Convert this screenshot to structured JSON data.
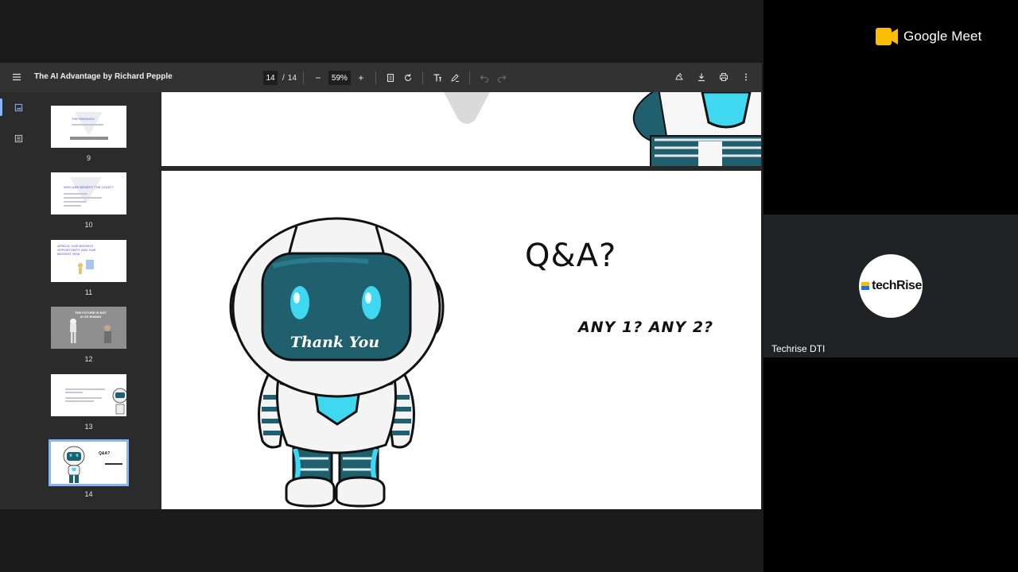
{
  "viewer": {
    "doc_title": "The AI Advantage by Richard Pepple",
    "current_page": "14",
    "page_separator": "/",
    "total_pages": "14",
    "zoom": "59%",
    "zoom_out_label": "−",
    "zoom_in_label": "+"
  },
  "thumbnails": [
    {
      "num": "9",
      "heading": "THE PARADOX"
    },
    {
      "num": "10",
      "heading": "WHO ARE BENEFIT THE LEAST?"
    },
    {
      "num": "11",
      "heading": "AFRICA: OUR BIGGEST OPPORTUNITY AND OUR BIGGEST RISK"
    },
    {
      "num": "12",
      "heading": "THE FUTURE IS NOT AI VS HUMAN"
    },
    {
      "num": "13",
      "heading": ""
    },
    {
      "num": "14",
      "heading": "Q&A?",
      "active": true
    }
  ],
  "slide": {
    "title": "Q&A?",
    "subtitle": "ANY 1? ANY 2?",
    "robot_visor_text": "Thank You"
  },
  "meet": {
    "logo_text": "Google Meet",
    "participant_name": "Techrise DTI",
    "avatar_logo_text": "techRise"
  },
  "colors": {
    "toolbar": "#323232",
    "sidebar": "#2b2b2b",
    "accent": "#8ab4f8",
    "robot_teal": "#1f5f6e",
    "robot_cyan": "#3fd8f0",
    "meet_yellow": "#fbbc04"
  },
  "icons": {
    "menu": "hamburger-icon",
    "fit": "fit-page-icon",
    "rotate": "rotate-icon",
    "text": "text-icon",
    "draw": "draw-icon",
    "undo": "undo-icon",
    "redo": "redo-icon",
    "annotate": "annotate-icon",
    "download": "download-icon",
    "print": "print-icon",
    "more": "more-vert-icon"
  }
}
